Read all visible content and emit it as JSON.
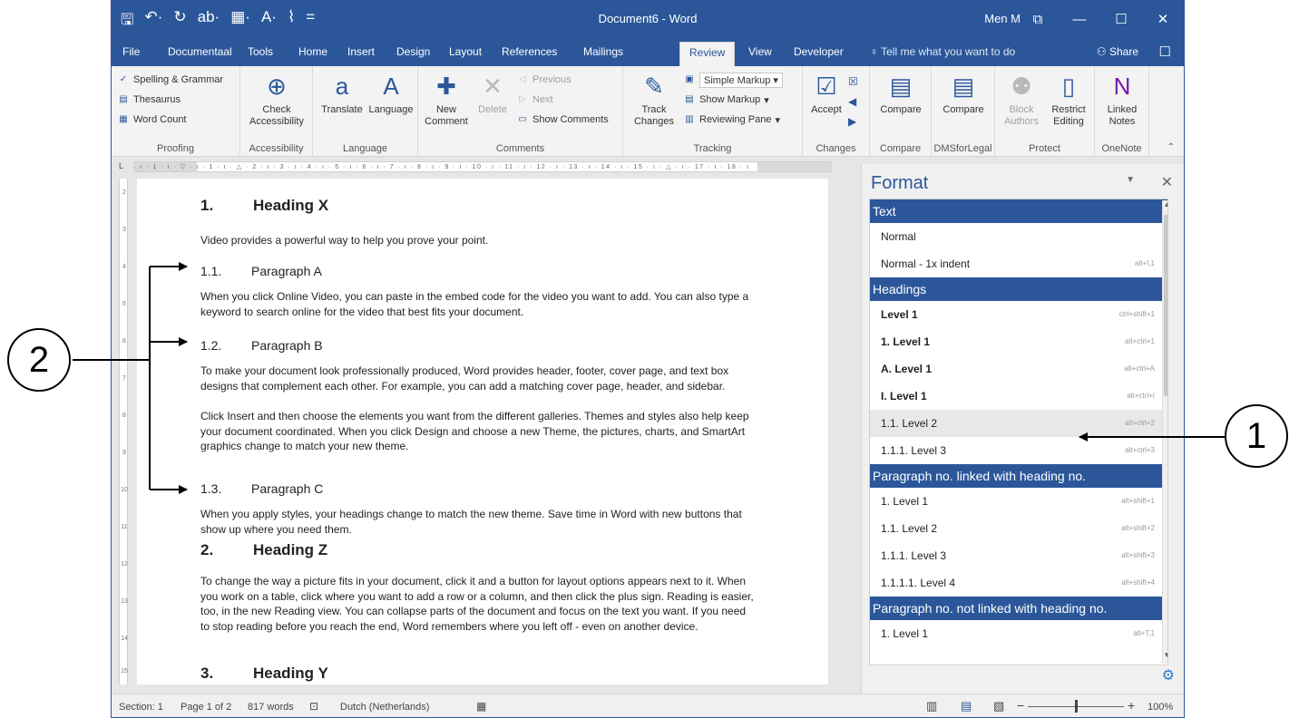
{
  "title_bar": {
    "qat": [
      "🖫",
      "↶·",
      "↻",
      "ab·",
      "▦·",
      "A·",
      "⌇",
      "="
    ],
    "doc_title": "Document6 - Word",
    "user": "Men M",
    "controls": [
      "⧉",
      "—",
      "☐",
      "✕"
    ]
  },
  "tabs": {
    "items": [
      "File",
      "Documentaal",
      "Tools",
      "Home",
      "Insert",
      "Design",
      "Layout",
      "References",
      "Mailings",
      "Review",
      "View",
      "Developer"
    ],
    "active": "Review",
    "tell_me": "Tell me what you want to do",
    "share": "Share"
  },
  "ribbon": {
    "proofing": {
      "label": "Proofing",
      "spelling": "Spelling & Grammar",
      "thesaurus": "Thesaurus",
      "word_count": "Word Count"
    },
    "accessibility": {
      "label": "Accessibility",
      "check": "Check",
      "check2": "Accessibility"
    },
    "language": {
      "label": "Language",
      "translate": "Translate",
      "language": "Language"
    },
    "comments": {
      "label": "Comments",
      "new": "New",
      "new2": "Comment",
      "delete": "Delete",
      "previous": "Previous",
      "next": "Next",
      "show": "Show Comments"
    },
    "tracking": {
      "label": "Tracking",
      "track": "Track",
      "track2": "Changes",
      "markup_select": "Simple Markup",
      "show_markup": "Show Markup",
      "reviewing_pane": "Reviewing Pane"
    },
    "changes": {
      "label": "Changes",
      "accept": "Accept"
    },
    "compare": {
      "label": "Compare",
      "btn": "Compare"
    },
    "dms": {
      "label": "DMSforLegal",
      "btn": "Compare"
    },
    "protect": {
      "label": "Protect",
      "block": "Block",
      "block2": "Authors",
      "restrict": "Restrict",
      "restrict2": "Editing"
    },
    "onenote": {
      "label": "OneNote",
      "linked": "Linked",
      "linked2": "Notes"
    }
  },
  "ruler": {
    "corner": "L",
    "text": "· ı · 1 · ı · ▽ · ı · 1 · ı · △ · 2 · ı · 3 · ı · 4 · ı · 5 · ı · 6 · ı · 7 · ı · 8 · ı · 9 · ı · 10 · ı · 11 · ı · 12 · ı · 13 · ı · 14 · ı · 15 · ı · △ · ı · 17 · ı · 18 · ı",
    "vticks": [
      "2",
      "3",
      "4",
      "5",
      "6",
      "7",
      "8",
      "9",
      "10",
      "11",
      "12",
      "13",
      "14",
      "15"
    ]
  },
  "document": {
    "h1a": {
      "num": "1.",
      "text": "Heading X"
    },
    "p0": "Video provides a powerful way to help you prove your point.",
    "h2a": {
      "num": "1.1.",
      "text": "Paragraph A"
    },
    "p1": "When you click Online Video, you can paste in the embed code for the video you want to add. You can also type a keyword to search online for the video that best fits your document.",
    "h2b": {
      "num": "1.2.",
      "text": "Paragraph B"
    },
    "p2": "To make your document look professionally produced, Word provides header, footer, cover page, and text box designs that complement each other. For example, you can add a matching cover page, header, and sidebar.",
    "p3": "Click Insert and then choose the elements you want from the different galleries. Themes and styles also help keep your document coordinated. When you click Design and choose a new Theme, the pictures, charts, and SmartArt graphics change to match your new theme.",
    "h2c": {
      "num": "1.3.",
      "text": "Paragraph C"
    },
    "p4": "When you apply styles, your headings change to match the new theme. Save time in Word with new buttons that show up where you need them.",
    "h1b": {
      "num": "2.",
      "text": "Heading Z"
    },
    "p5": "To change the way a picture fits in your document, click it and a button for layout options appears next to it. When you work on a table, click where you want to add a row or a column, and then click the plus sign. Reading is easier, too, in the new Reading view. You can collapse parts of the document and focus on the text you want. If you need to stop reading before you reach the end, Word remembers where you left off - even on another device.",
    "h1c": {
      "num": "3.",
      "text": "Heading Y"
    }
  },
  "format_pane": {
    "title": "Format",
    "sections": [
      {
        "title": "Text",
        "rows": [
          {
            "name": "Normal",
            "shortcut": "",
            "bold": false
          },
          {
            "name": "Normal - 1x indent",
            "shortcut": "alt+I,1",
            "bold": false
          }
        ]
      },
      {
        "title": "Headings",
        "rows": [
          {
            "name": "Level 1",
            "shortcut": "ctrl+shift+1",
            "bold": true
          },
          {
            "name": "1. Level 1",
            "shortcut": "alt+ctrl+1",
            "bold": true
          },
          {
            "name": "A. Level 1",
            "shortcut": "alt+ctrl+A",
            "bold": true
          },
          {
            "name": "I. Level 1",
            "shortcut": "alt+ctrl+I",
            "bold": true
          },
          {
            "name": "1.1. Level 2",
            "shortcut": "alt+ctrl+2",
            "bold": false,
            "selected": true
          },
          {
            "name": "1.1.1. Level 3",
            "shortcut": "alt+ctrl+3",
            "bold": false
          }
        ]
      },
      {
        "title": "Paragraph no. linked with heading no.",
        "rows": [
          {
            "name": "1. Level 1",
            "shortcut": "alt+shift+1",
            "bold": false
          },
          {
            "name": "1.1. Level 2",
            "shortcut": "alt+shift+2",
            "bold": false
          },
          {
            "name": "1.1.1. Level 3",
            "shortcut": "alt+shift+3",
            "bold": false
          },
          {
            "name": "1.1.1.1. Level 4",
            "shortcut": "alt+shift+4",
            "bold": false
          }
        ]
      },
      {
        "title": "Paragraph no. not linked with heading no.",
        "rows": [
          {
            "name": "1. Level 1",
            "shortcut": "alt+T,1",
            "bold": false
          }
        ]
      }
    ]
  },
  "status_bar": {
    "section": "Section: 1",
    "page": "Page 1 of 2",
    "words": "817 words",
    "language": "Dutch (Netherlands)",
    "zoom": "100%"
  },
  "callouts": {
    "one": "1",
    "two": "2"
  }
}
